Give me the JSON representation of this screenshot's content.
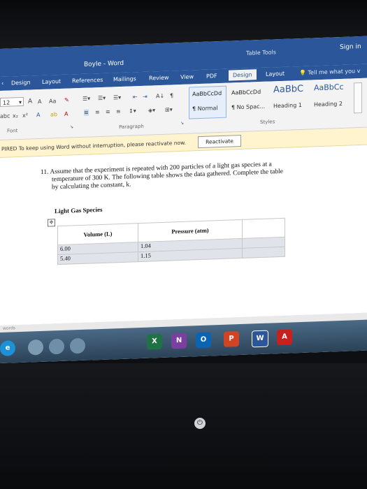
{
  "titlebar": {
    "doc_title": "Boyle  -  Word",
    "table_tools": "Table Tools",
    "sign_in": "Sign in"
  },
  "tabs": [
    {
      "label": "Design"
    },
    {
      "label": "Layout"
    },
    {
      "label": "References"
    },
    {
      "label": "Mailings"
    },
    {
      "label": "Review"
    },
    {
      "label": "View"
    },
    {
      "label": "PDF"
    },
    {
      "label": "Design"
    },
    {
      "label": "Layout"
    }
  ],
  "tell_me": "Tell me what you v",
  "ribbon": {
    "font_size": "12",
    "font_group_label": "Font",
    "paragraph_group_label": "Paragraph",
    "styles_group_label": "Styles",
    "styles": [
      {
        "sample": "AaBbCcDd",
        "name": "¶ Normal"
      },
      {
        "sample": "AaBbCcDd",
        "name": "¶ No Spac..."
      },
      {
        "sample": "AaBbC",
        "name": "Heading 1"
      },
      {
        "sample": "AaBbCc",
        "name": "Heading 2"
      }
    ],
    "icons": {
      "grow_font": "A",
      "shrink_font": "A",
      "change_case": "Aa",
      "subscript": "x₂",
      "superscript": "x²",
      "font_color": "A",
      "highlight": "ab",
      "text_effects": "A",
      "pilcrow": "¶",
      "sort": "A↓"
    }
  },
  "infobar": {
    "message": "PIRED  To keep using Word without interruption, please reactivate now.",
    "button": "Reactivate"
  },
  "document": {
    "question_lines": [
      "11. Assume that the experiment is repeated with 200 particles of a light gas species at a",
      "temperature of 300 K. The following table shows the data gathered. Complete the table",
      "by calculating the constant, k."
    ],
    "table_caption": "Light Gas Species",
    "table": {
      "headers": [
        "Volume (L)",
        "Pressure (atm)",
        ""
      ],
      "rows": [
        [
          "6.00",
          "1.04",
          ""
        ],
        [
          "5.40",
          "1.15",
          ""
        ]
      ]
    }
  },
  "statusbar": {
    "text": "words"
  },
  "taskbar": {
    "apps": [
      {
        "name": "ie",
        "glyph": "e",
        "color": "#1e90d6"
      },
      {
        "name": "excel",
        "glyph": "X",
        "color": "#1f7244"
      },
      {
        "name": "onenote",
        "glyph": "N",
        "color": "#7b3fa0"
      },
      {
        "name": "outlook",
        "glyph": "O",
        "color": "#0a64b4"
      },
      {
        "name": "powerpoint",
        "glyph": "P",
        "color": "#d04424"
      },
      {
        "name": "word",
        "glyph": "W",
        "color": "#2b579a"
      },
      {
        "name": "acrobat",
        "glyph": "A",
        "color": "#c8201f"
      }
    ]
  }
}
